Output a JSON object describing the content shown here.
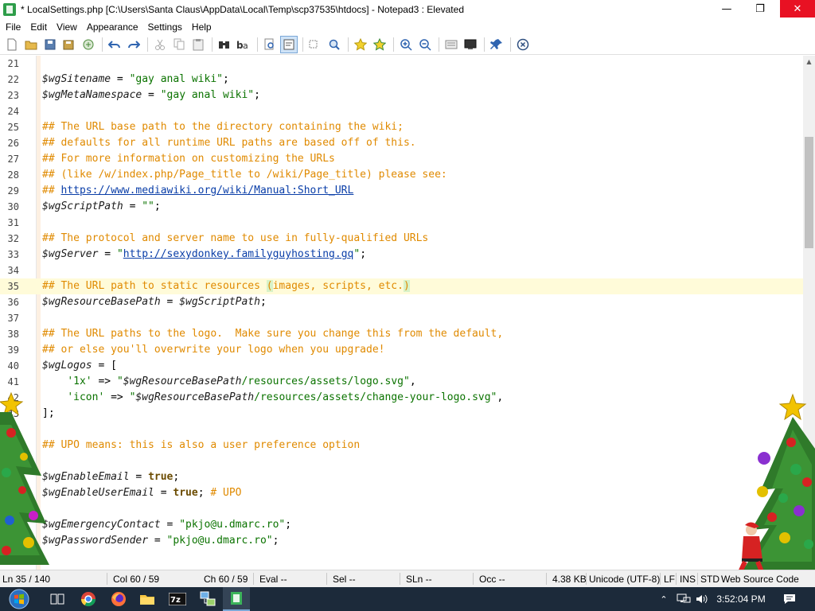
{
  "window": {
    "title": "* LocalSettings.php [C:\\Users\\Santa Claus\\AppData\\Local\\Temp\\scp37535\\htdocs] - Notepad3 : Elevated",
    "minimize_icon": "minimize-icon",
    "maximize_icon": "maximize-icon",
    "close_icon": "close-icon"
  },
  "menu": {
    "items": [
      "File",
      "Edit",
      "View",
      "Appearance",
      "Settings",
      "Help"
    ]
  },
  "toolbar": {
    "icons": [
      "new-file-icon",
      "open-folder-icon",
      "save-icon",
      "save-all-icon",
      "browse-icon",
      "undo-icon",
      "redo-icon",
      "cut-icon",
      "copy-icon",
      "paste-icon",
      "find-icon",
      "replace-icon",
      "find-in-files-icon",
      "word-wrap-icon",
      "zoom-icon",
      "find-next-icon",
      "bookmark-icon",
      "bookmark-all-icon",
      "zoom-in-icon",
      "zoom-out-icon",
      "view-settings-icon",
      "monitor-icon",
      "pin-icon",
      "close-file-icon"
    ]
  },
  "editor": {
    "current_line": 35,
    "lines": [
      {
        "n": "21",
        "segs": []
      },
      {
        "n": "22",
        "segs": [
          {
            "t": "$wgSitename",
            "c": "var"
          },
          {
            "t": " = ",
            "c": "punc"
          },
          {
            "t": "\"gay anal wiki\"",
            "c": "str"
          },
          {
            "t": ";",
            "c": "punc"
          }
        ]
      },
      {
        "n": "23",
        "segs": [
          {
            "t": "$wgMetaNamespace",
            "c": "var"
          },
          {
            "t": " = ",
            "c": "punc"
          },
          {
            "t": "\"gay anal wiki\"",
            "c": "str"
          },
          {
            "t": ";",
            "c": "punc"
          }
        ]
      },
      {
        "n": "24",
        "segs": []
      },
      {
        "n": "25",
        "segs": [
          {
            "t": "## The URL base path to the directory containing the wiki;",
            "c": "comment"
          }
        ]
      },
      {
        "n": "26",
        "segs": [
          {
            "t": "## defaults for all runtime URL paths are based off of this.",
            "c": "comment"
          }
        ]
      },
      {
        "n": "27",
        "segs": [
          {
            "t": "## For more information on customizing the URLs",
            "c": "comment"
          }
        ]
      },
      {
        "n": "28",
        "segs": [
          {
            "t": "## (like /w/index.php/Page_title to /wiki/Page_title) please see:",
            "c": "comment"
          }
        ]
      },
      {
        "n": "29",
        "segs": [
          {
            "t": "## ",
            "c": "comment"
          },
          {
            "t": "https://www.mediawiki.org/wiki/Manual:Short_URL",
            "c": "url"
          }
        ]
      },
      {
        "n": "30",
        "segs": [
          {
            "t": "$wgScriptPath",
            "c": "var"
          },
          {
            "t": " = ",
            "c": "punc"
          },
          {
            "t": "\"\"",
            "c": "str"
          },
          {
            "t": ";",
            "c": "punc"
          }
        ]
      },
      {
        "n": "31",
        "segs": []
      },
      {
        "n": "32",
        "segs": [
          {
            "t": "## The protocol and server name to use in fully-qualified URLs",
            "c": "comment"
          }
        ]
      },
      {
        "n": "33",
        "segs": [
          {
            "t": "$wgServer",
            "c": "var"
          },
          {
            "t": " = ",
            "c": "punc"
          },
          {
            "t": "\"",
            "c": "str"
          },
          {
            "t": "http://sexydonkey.familyguyhosting.gq",
            "c": "url"
          },
          {
            "t": "\"",
            "c": "str"
          },
          {
            "t": ";",
            "c": "punc"
          }
        ]
      },
      {
        "n": "34",
        "segs": []
      },
      {
        "n": "35",
        "segs": [
          {
            "t": "## The URL path to static resources ",
            "c": "comment"
          },
          {
            "t": "(",
            "c": "comment hl"
          },
          {
            "t": "images, scripts, etc.",
            "c": "comment"
          },
          {
            "t": ")",
            "c": "comment hl"
          }
        ]
      },
      {
        "n": "36",
        "segs": [
          {
            "t": "$wgResourceBasePath",
            "c": "var"
          },
          {
            "t": " = ",
            "c": "punc"
          },
          {
            "t": "$wgScriptPath",
            "c": "var"
          },
          {
            "t": ";",
            "c": "punc"
          }
        ]
      },
      {
        "n": "37",
        "segs": []
      },
      {
        "n": "38",
        "segs": [
          {
            "t": "## The URL paths to the logo.  Make sure you change this from the default,",
            "c": "comment"
          }
        ]
      },
      {
        "n": "39",
        "segs": [
          {
            "t": "## or else you'll overwrite your logo when you upgrade!",
            "c": "comment"
          }
        ]
      },
      {
        "n": "40",
        "segs": [
          {
            "t": "$wgLogos",
            "c": "var"
          },
          {
            "t": " = [",
            "c": "punc"
          }
        ]
      },
      {
        "n": "41",
        "segs": [
          {
            "t": "    ",
            "c": "punc"
          },
          {
            "t": "'1x'",
            "c": "str"
          },
          {
            "t": " => ",
            "c": "punc"
          },
          {
            "t": "\"",
            "c": "str"
          },
          {
            "t": "$wgResourceBasePath",
            "c": "var"
          },
          {
            "t": "/resources/assets/logo.svg\"",
            "c": "str"
          },
          {
            "t": ",",
            "c": "punc"
          }
        ]
      },
      {
        "n": "42",
        "segs": [
          {
            "t": "    ",
            "c": "punc"
          },
          {
            "t": "'icon'",
            "c": "str"
          },
          {
            "t": " => ",
            "c": "punc"
          },
          {
            "t": "\"",
            "c": "str"
          },
          {
            "t": "$wgResourceBasePath",
            "c": "var"
          },
          {
            "t": "/resources/assets/change-your-logo.svg\"",
            "c": "str"
          },
          {
            "t": ",",
            "c": "punc"
          }
        ]
      },
      {
        "n": "43",
        "segs": [
          {
            "t": "];",
            "c": "punc"
          }
        ]
      },
      {
        "n": "44",
        "segs": []
      },
      {
        "n": "45",
        "segs": [
          {
            "t": "## UPO means: this is also a user preference option",
            "c": "comment"
          }
        ]
      },
      {
        "n": "46",
        "segs": []
      },
      {
        "n": "47",
        "segs": [
          {
            "t": "$wgEnableEmail",
            "c": "var"
          },
          {
            "t": " = ",
            "c": "punc"
          },
          {
            "t": "true",
            "c": "kw"
          },
          {
            "t": ";",
            "c": "punc"
          }
        ]
      },
      {
        "n": "48",
        "segs": [
          {
            "t": "$wgEnableUserEmail",
            "c": "var"
          },
          {
            "t": " = ",
            "c": "punc"
          },
          {
            "t": "true",
            "c": "kw"
          },
          {
            "t": "; ",
            "c": "punc"
          },
          {
            "t": "# UPO",
            "c": "comment"
          }
        ]
      },
      {
        "n": "49",
        "segs": []
      },
      {
        "n": "50",
        "segs": [
          {
            "t": "$wgEmergencyContact",
            "c": "var"
          },
          {
            "t": " = ",
            "c": "punc"
          },
          {
            "t": "\"pkjo@u.dmarc.ro\"",
            "c": "str"
          },
          {
            "t": ";",
            "c": "punc"
          }
        ]
      },
      {
        "n": "51",
        "segs": [
          {
            "t": "$wgPasswordSender",
            "c": "var"
          },
          {
            "t": " = ",
            "c": "punc"
          },
          {
            "t": "\"pkjo@u.dmarc.ro\"",
            "c": "str"
          },
          {
            "t": ";",
            "c": "punc"
          }
        ]
      }
    ]
  },
  "statusbar": {
    "ln": "Ln 35 / 140",
    "col": "Col 60 / 59",
    "ch": "Ch 60 / 59",
    "eval": "Eval --",
    "sel": "Sel --",
    "sln": "SLn --",
    "occ": "Occ --",
    "size": "4.38 KB",
    "encoding": "Unicode (UTF-8)",
    "eol": "LF",
    "ins": "INS",
    "std": "STD",
    "lexer": "Web Source Code"
  },
  "taskbar": {
    "start_icon": "windows-start-icon",
    "apps": [
      "task-view-icon",
      "chrome-icon",
      "firefox-icon",
      "file-explorer-icon",
      "7zip-icon",
      "winscp-icon",
      "notepad3-icon"
    ],
    "clock": "3:52:04 PM",
    "tray_icons": [
      "chevron-up-icon",
      "network-icon",
      "volume-icon",
      "notification-icon"
    ]
  },
  "colors": {
    "comment": "#e08a00",
    "string": "#0b7300",
    "url": "#0a3ea8",
    "current_line": "#fffbd9",
    "close_button": "#e81123",
    "taskbar": "#1c2a3a"
  }
}
